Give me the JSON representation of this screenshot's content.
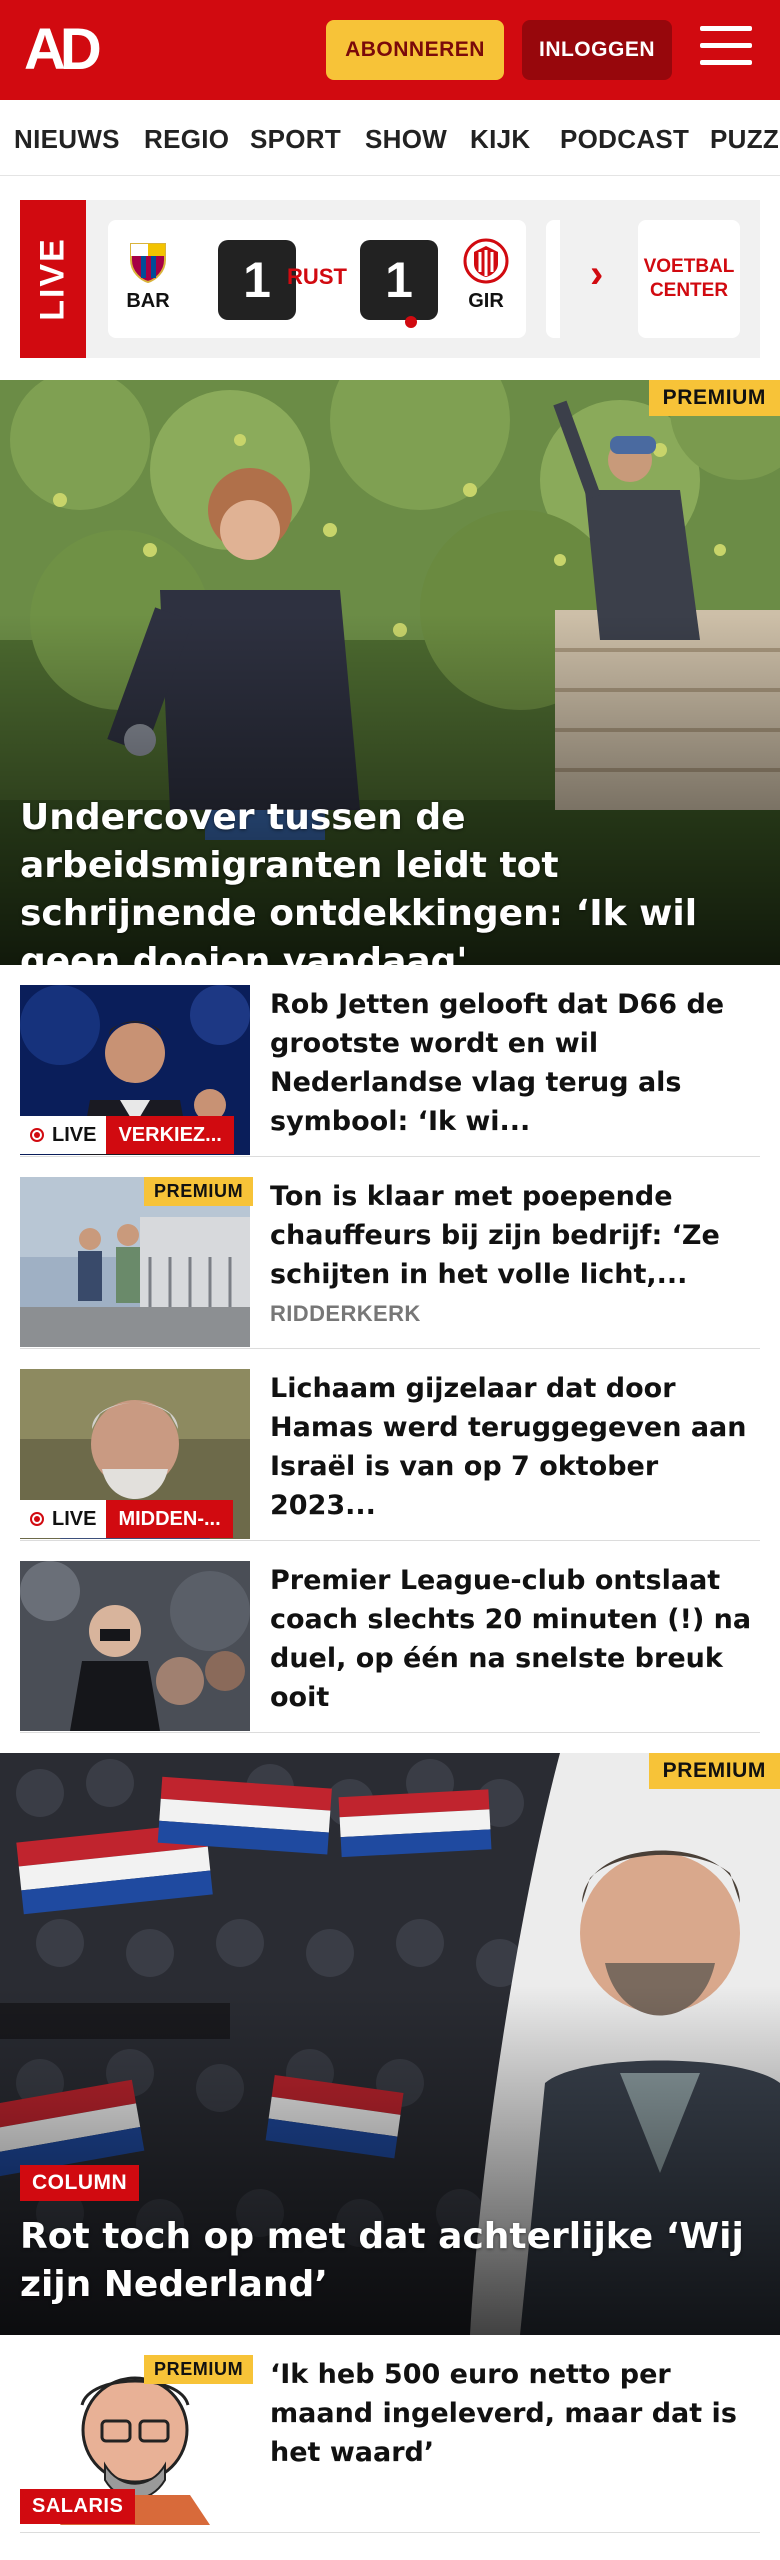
{
  "header": {
    "logo": "AD",
    "subscribe_label": "ABONNEREN",
    "login_label": "INLOGGEN",
    "menu_icon": "hamburger-icon"
  },
  "nav": {
    "items": [
      "NIEUWS",
      "REGIO",
      "SPORT",
      "SHOW",
      "KIJK",
      "PODCAST",
      "PUZZ"
    ]
  },
  "live": {
    "label": "LIVE",
    "match": {
      "home": "BAR",
      "away": "GIR",
      "home_score": "1",
      "away_score": "1",
      "status": "RUST"
    },
    "voetbal_center": "VOETBAL CENTER"
  },
  "hero": {
    "premium": "PREMIUM",
    "title": "Undercover tussen de arbeidsmigranten leidt tot schrijnende ontdekkingen: ‘Ik wil geen dooien vandaag'"
  },
  "articles": [
    {
      "title": "Rob Jetten gelooft dat D66 de grootste wordt en wil Nederlandse vlag terug als symbool: ‘Ik wi...",
      "live": "LIVE",
      "tag": "VERKIEZ..."
    },
    {
      "title": "Ton is klaar met poepende chauffeurs bij zijn bedrijf: ‘Ze schijten in het volle licht,...",
      "premium": "PREMIUM",
      "location": "RIDDERKERK"
    },
    {
      "title": "Lichaam gijzelaar dat door Hamas werd teruggegeven aan Israël is van op 7 oktober 2023...",
      "live": "LIVE",
      "tag": "MIDDEN-..."
    },
    {
      "title": "Premier League-club ontslaat coach slechts 20 minuten (!) na duel, op één na snelste breuk ooit"
    }
  ],
  "hero2": {
    "premium": "PREMIUM",
    "category": "COLUMN",
    "title": "Rot toch op met dat achterlijke ‘Wij zijn Nederland’"
  },
  "article5": {
    "premium": "PREMIUM",
    "category": "SALARIS",
    "title": "‘Ik heb 500 euro netto per maand ingeleverd, maar dat is het waard’"
  },
  "colors": {
    "brand_red": "#d10a10",
    "premium_yellow": "#f7c338",
    "dark_red": "#97070c"
  }
}
